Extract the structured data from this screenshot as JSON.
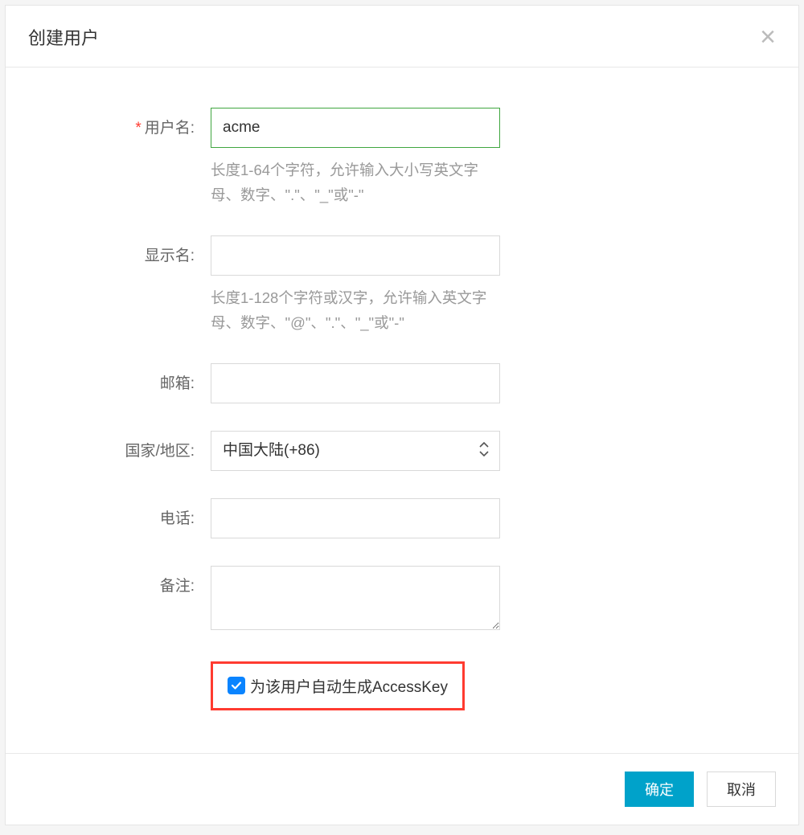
{
  "modal": {
    "title": "创建用户",
    "close_label": "×"
  },
  "form": {
    "username": {
      "label": "用户名:",
      "value": "acme",
      "help": "长度1-64个字符，允许输入大小写英文字母、数字、\".\"、\"_\"或\"-\""
    },
    "displayname": {
      "label": "显示名:",
      "value": "",
      "help": "长度1-128个字符或汉字，允许输入英文字母、数字、\"@\"、\".\"、\"_\"或\"-\""
    },
    "email": {
      "label": "邮箱:",
      "value": ""
    },
    "region": {
      "label": "国家/地区:",
      "selected": "中国大陆(+86)"
    },
    "phone": {
      "label": "电话:",
      "value": ""
    },
    "remark": {
      "label": "备注:",
      "value": ""
    },
    "accesskey": {
      "label": "为该用户自动生成AccessKey",
      "checked": true
    }
  },
  "footer": {
    "ok": "确定",
    "cancel": "取消"
  }
}
